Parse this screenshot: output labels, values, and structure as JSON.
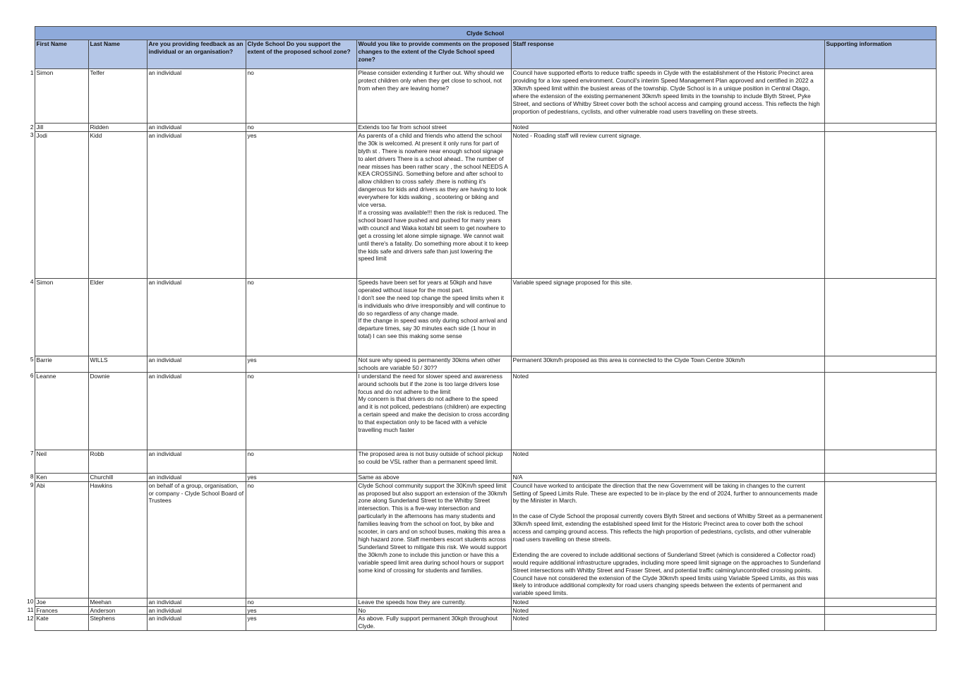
{
  "sheet": {
    "title": "Clyde School",
    "columns": [
      "First Name",
      "Last Name",
      "Are you providing feedback as an individual or an organisation?",
      "Clyde School Do you support the extent of the proposed school zone?",
      "Would you like to provide comments on the proposed changes to the extent of the Clyde School speed zone?",
      "Staff response",
      "Supporting information"
    ],
    "rows": [
      {
        "num": "1",
        "first": "Simon",
        "last": "Telfer",
        "type": "an individual",
        "support": "no",
        "comment": "Please consider extending it further out. Why should we protect children only when they get close to school, not from when they are leaving home?",
        "response": "Council have supported efforts to reduce traffic speeds in Clyde with the establishment of the Historic Precinct area providing for a low speed environment. Council's interim Speed Management Plan approved and certified in 2022 a 30km/h speed limit within the busiest areas of the township. Clyde School is in a unique position in Central Otago, where the extension of the existing permanenent 30km/h speed limits in the township to include Blyth Street, Pyke Street, and sections of Whitby Street cover both the school access and camping ground access. This reflects the high proportion of pedestrians, cyclists, and other vulnerable road users travelling on these streets.",
        "info": ""
      },
      {
        "num": "2",
        "first": "Jill",
        "last": "Ridden",
        "type": "an individual",
        "support": "no",
        "comment": "Extends too far from school street",
        "response": "Noted",
        "info": ""
      },
      {
        "num": "3",
        "first": "Jodi",
        "last": "Kidd",
        "type": "an individual",
        "support": "yes",
        "comment": "As parents of a child and friends who attend the school the 30k is welcomed.  At present it only runs for part of blyth st . There is nowhere near enough school signage to alert drivers There is a  school ahead.. The number of near misses has been rather scary , the school NEEDS A KEA CROSSING.  Something before and after school to allow children to cross safely  .there is nothing it's dangerous for kids and drivers as they are having to look everywhere for kids walking , scootering or biking  and vice versa.\nIf a crossing was available!!! then the risk is reduced. The school  board have pushed and pushed for many years with council and Waka kotahi bit seem to get nowhere to get a crossing let alone simple signage. We cannot wait until there's a fatality.  Do something more about it to keep the kids safe  and drivers safe than just lowering the speed limit",
        "response": "Noted - Roading staff will review current signage.",
        "info": ""
      },
      {
        "num": "4",
        "first": "Simon",
        "last": "Elder",
        "type": "an individual",
        "support": "no",
        "comment": "Speeds have been set for years at 50kph and have operated without issue for the most part.\nI don't see the need top change the speed limits when it is individuals who drive irresponsibly and will continue to do so regardless of any change made.\nIf the change in speed was only during school arrival and departure times, say 30 minutes each side (1 hour in total) I can see this making some sense",
        "response": "Variable speed signage proposed for this site.",
        "info": ""
      },
      {
        "num": "5",
        "first": "Barrie",
        "last": "WILLS",
        "type": "an individual",
        "support": "yes",
        "comment": "Not sure why speed is permanently 30kms when other schools are variable 50 / 30??",
        "response": "Permanent 30km/h proposed as this area is connected to the Clyde Town Centre 30km/h",
        "info": ""
      },
      {
        "num": "6",
        "first": "Leanne",
        "last": "Downie",
        "type": "an individual",
        "support": "no",
        "comment": "I understand the need for slower speed and awareness around schools but if the zone is too large drivers lose focus and do not adhere to the limit\nMy concern is that drivers do not adhere to the speed and it is not policed, pedestrians (children) are expecting a certain speed and make the decision to cross according to that expectation only to be faced with a vehicle travelling much faster",
        "response": "Noted",
        "info": ""
      },
      {
        "num": "7",
        "first": "Neil",
        "last": "Robb",
        "type": "an individual",
        "support": "no",
        "comment": "The proposed area is not busy outside of school pickup so could be VSL rather than a permanent speed limit.",
        "response": "Noted",
        "info": ""
      },
      {
        "num": "8",
        "first": "Ken",
        "last": "Churchill",
        "type": "an individual",
        "support": "yes",
        "comment": "Same as above",
        "response": "N/A",
        "info": ""
      },
      {
        "num": "9",
        "first": "Abi",
        "last": "Hawkins",
        "type": "on behalf of a group, organisation, or company - Clyde School Board of Trustees",
        "support": "no",
        "comment": "Clyde School community support the 30Km/h speed limit as proposed but also support an extension of the 30km/h zone along Sunderland Street to the Whitby Street intersection. This is a five-way intersection and particularly in the afternoons has many students and families leaving from the school on foot, by bike and scooter, in cars and on school buses, making this area a high hazard zone. Staff members escort students across Sunderland Street to mitigate this risk. We would support the 30km/h zone to include this junction or have this a variable speed limit area during school hours or support some kind of crossing for students and families.",
        "response": "Council have worked to anticipate the direction that the new Government will be taking in changes to the current Setting of Speed Limits Rule. These are expected to be in-place by the end of 2024, further to announcements made by the Minister in March.\n\nIn the case of Clyde School the proposal currently covers Blyth Street and sections of Whitby Street as a permanenent 30km/h speed limit, extending the established speed limit for the Historic Precinct area to cover both the school access and camping ground access. This reflects the high proportion of pedestrians, cyclists, and other vulnerable road users travelling on these streets.\n\nExtending the are covered to include additional sections of Sunderland Street (which is considered a Collector road) would require additional infrastructure upgrades, including more speed limit signage on the approaches to Sunderland Street intersections with Whitby Street and Fraser Street, and potential traffic calming/uncontrolled crossing points. Council have not considered the extension of the Clyde 30km/h speed limits using Variable Speed Limits, as this was likely to introduce additional complexity for road users changing speeds between the extents of permanent and variable speed limits.",
        "info": ""
      },
      {
        "num": "10",
        "first": "Joe",
        "last": "Meehan",
        "type": "an individual",
        "support": "no",
        "comment": "Leave the speeds how they are currently.",
        "response": "Noted",
        "info": ""
      },
      {
        "num": "11",
        "first": "Frances",
        "last": "Anderson",
        "type": "an individual",
        "support": "yes",
        "comment": "No",
        "response": "Noted",
        "info": ""
      },
      {
        "num": "12",
        "first": "Kate",
        "last": "Stephens",
        "type": "an individual",
        "support": "yes",
        "comment": "As above. Fully support permanent 30kph throughout Clyde.",
        "response": "Noted",
        "info": ""
      }
    ],
    "colors": {
      "title_bg": "#8eaadb",
      "header_bg": "#b4c6e7",
      "border": "#4a4a4a"
    }
  }
}
